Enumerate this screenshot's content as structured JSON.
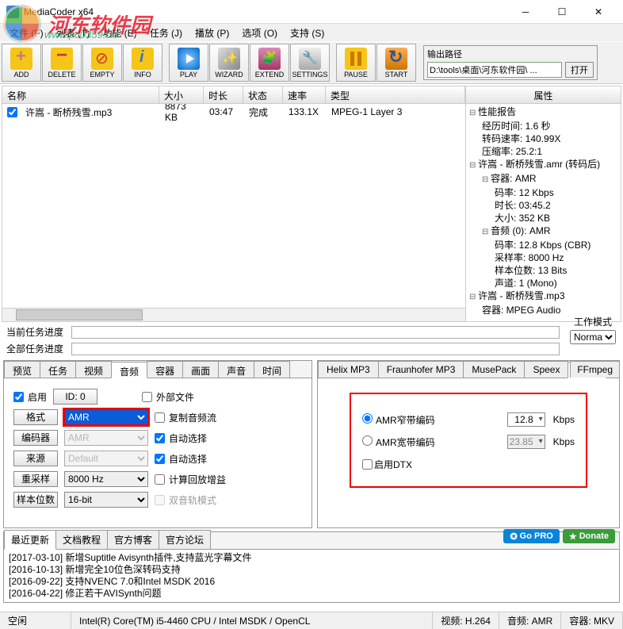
{
  "window": {
    "title": "MediaCoder x64"
  },
  "watermark": {
    "text": "河东软件园",
    "url": "www.pc0359.cn"
  },
  "menu": {
    "file": "文件 (F)",
    "list": "列表 (T)",
    "function": "功能 (E)",
    "task": "任务 (J)",
    "play": "播放 (P)",
    "option": "选项 (O)",
    "support": "支持 (S)"
  },
  "toolbar": {
    "add": "ADD",
    "delete": "DELETE",
    "empty": "EMPTY",
    "info": "INFO",
    "play": "PLAY",
    "wizard": "WIZARD",
    "extend": "EXTEND",
    "settings": "SETTINGS",
    "pause": "PAUSE",
    "start": "START"
  },
  "output": {
    "label": "输出路径",
    "path": "D:\\tools\\桌面\\河东软件园\\ ...",
    "open": "打开"
  },
  "filelist": {
    "cols": {
      "name": "名称",
      "size": "大小",
      "duration": "时长",
      "status": "状态",
      "rate": "速率",
      "type": "类型"
    },
    "rows": [
      {
        "name": "许嵩 - 断桥残雪.mp3",
        "size": "8873 KB",
        "duration": "03:47",
        "status": "完成",
        "rate": "133.1X",
        "type": "MPEG-1 Layer 3"
      }
    ]
  },
  "props": {
    "title": "属性",
    "perf": {
      "label": "性能报告",
      "elapsed": "经历时间: 1.6 秒",
      "speed": "转码速率: 140.99X",
      "ratio": "压缩率: 25.2:1"
    },
    "out": {
      "label": "许嵩 - 断桥残雪.amr (转码后)",
      "container": {
        "label": "容器: AMR",
        "bitrate": "码率: 12 Kbps",
        "dur": "时长: 03:45.2",
        "size": "大小: 352 KB"
      },
      "audio": {
        "label": "音频 (0): AMR",
        "bitrate": "码率: 12.8 Kbps (CBR)",
        "sample": "采样率: 8000 Hz",
        "bits": "样本位数: 13 Bits",
        "ch": "声道: 1 (Mono)"
      }
    },
    "src": {
      "label": "许嵩 - 断桥残雪.mp3",
      "container": "容器: MPEG Audio"
    }
  },
  "progress": {
    "current": "当前任务进度",
    "all": "全部任务进度",
    "workmode_label": "工作模式",
    "workmode": "Normal"
  },
  "left_tabs": {
    "preview": "预览",
    "task": "任务",
    "video": "视频",
    "audio": "音频",
    "container": "容器",
    "picture": "画面",
    "sound": "声音",
    "time": "时间"
  },
  "audio_tab": {
    "enable": "启用",
    "id_label": "ID: 0",
    "external": "外部文件",
    "format": "格式",
    "format_val": "AMR",
    "copy": "复制音频流",
    "encoder": "编码器",
    "encoder_val": "AMR",
    "auto1": "自动选择",
    "source": "来源",
    "source_val": "Default",
    "auto2": "自动选择",
    "resample": "重采样",
    "resample_val": "8000 Hz",
    "gain": "计算回放增益",
    "samplebits": "样本位数",
    "samplebits_val": "16-bit",
    "dual": "双音轨模式"
  },
  "right_tabs": {
    "helix": "Helix MP3",
    "fraun": "Fraunhofer MP3",
    "muse": "MusePack",
    "speex": "Speex",
    "amr": "AMR",
    "ffmpeg": "FFmpeg"
  },
  "amr_panel": {
    "narrow": "AMR窄带编码",
    "narrow_val": "12.8",
    "kbps": "Kbps",
    "wide": "AMR宽带编码",
    "wide_val": "23.85",
    "dtx": "启用DTX"
  },
  "bottom_tabs": {
    "news": "最近更新",
    "docs": "文档教程",
    "blog": "官方博客",
    "forum": "官方论坛"
  },
  "news": [
    "[2017-03-10] 新增Suptitle Avisynth插件,支持蓝光字幕文件",
    "[2016-10-13] 新增完全10位色深转码支持",
    "[2016-09-22] 支持NVENC 7.0和Intel MSDK 2016",
    "[2016-04-22] 修正若干AVISynth问题"
  ],
  "badges": {
    "pro": "Go PRO",
    "donate": "Donate"
  },
  "status": {
    "idle": "空闲",
    "cpu": "Intel(R) Core(TM) i5-4460 CPU  / Intel MSDK / OpenCL",
    "video": "视频: H.264",
    "audio": "音频: AMR",
    "container": "容器: MKV"
  }
}
